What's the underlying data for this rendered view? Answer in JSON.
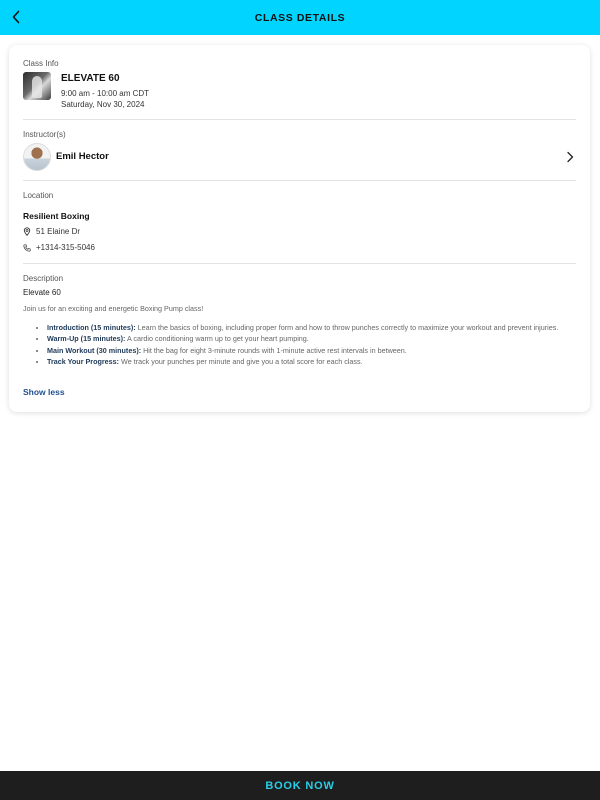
{
  "header": {
    "title": "CLASS DETAILS",
    "back_icon": "chevron-left-icon"
  },
  "class_info": {
    "label": "Class Info",
    "name": "ELEVATE 60",
    "time": "9:00 am - 10:00 am CDT",
    "date": "Saturday, Nov 30, 2024"
  },
  "instructors": {
    "label": "Instructor(s)",
    "items": [
      {
        "name": "Emil Hector"
      }
    ]
  },
  "location": {
    "label": "Location",
    "name": "Resilient Boxing",
    "address": "51 Elaine Dr",
    "phone": "+1314-315-5046"
  },
  "description": {
    "label": "Description",
    "title": "Elevate 60",
    "intro": "Join us for an exciting and energetic Boxing Pump class!",
    "bullets": [
      {
        "label": "Introduction (15 minutes):",
        "text": " Learn the basics of boxing, including proper form and how to throw punches correctly to maximize your workout and prevent injuries."
      },
      {
        "label": "Warm-Up (15 minutes):",
        "text": " A cardio conditioning warm up to get your heart pumping."
      },
      {
        "label": "Main Workout (30 minutes):",
        "text": " Hit the bag for eight 3-minute rounds with 1-minute active rest intervals in between."
      },
      {
        "label": "Track Your Progress:",
        "text": " We track your punches per minute and give you a total score for each class."
      }
    ],
    "toggle_label": "Show less"
  },
  "footer": {
    "book_label": "BOOK NOW"
  },
  "colors": {
    "header_bg": "#00d4ff",
    "footer_bg": "#1e1e1e",
    "accent": "#29cfe8",
    "link": "#1f4f8f"
  }
}
